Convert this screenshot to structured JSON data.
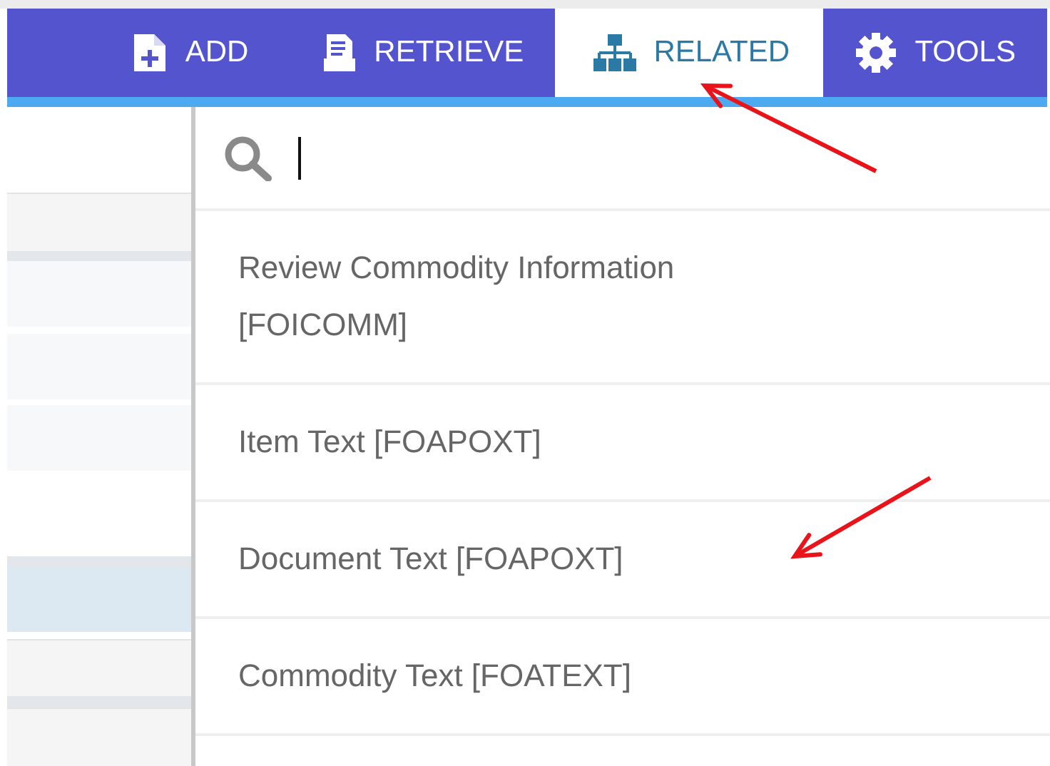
{
  "toolbar": {
    "tabs": [
      {
        "label": "ADD",
        "kind": "add",
        "selected": false
      },
      {
        "label": "RETRIEVE",
        "kind": "retrieve",
        "selected": false
      },
      {
        "label": "RELATED",
        "kind": "related",
        "selected": true
      },
      {
        "label": "TOOLS",
        "kind": "tools",
        "selected": false
      }
    ]
  },
  "left_panel": {
    "rows": [
      {
        "kind": "blank"
      },
      {
        "kind": "header"
      },
      {
        "kind": "separator"
      },
      {
        "kind": "row",
        "selected": false
      },
      {
        "kind": "gap"
      },
      {
        "kind": "row",
        "selected": false
      },
      {
        "kind": "gap"
      },
      {
        "kind": "row",
        "selected": false
      },
      {
        "kind": "blank"
      },
      {
        "kind": "separator"
      },
      {
        "kind": "row",
        "selected": true
      },
      {
        "kind": "gap"
      },
      {
        "kind": "header"
      },
      {
        "kind": "separator"
      },
      {
        "kind": "header"
      }
    ]
  },
  "related_menu": {
    "search": {
      "focused": true
    },
    "items": [
      {
        "label": "Review Commodity Information [FOICOMM]"
      },
      {
        "label": "Item Text [FOAPOXT]"
      },
      {
        "label": "Document Text [FOAPOXT]"
      },
      {
        "label": "Commodity Text [FOATEXT]"
      }
    ]
  },
  "annotations": [
    {
      "kind": "arrow"
    },
    {
      "kind": "arrow"
    }
  ]
}
